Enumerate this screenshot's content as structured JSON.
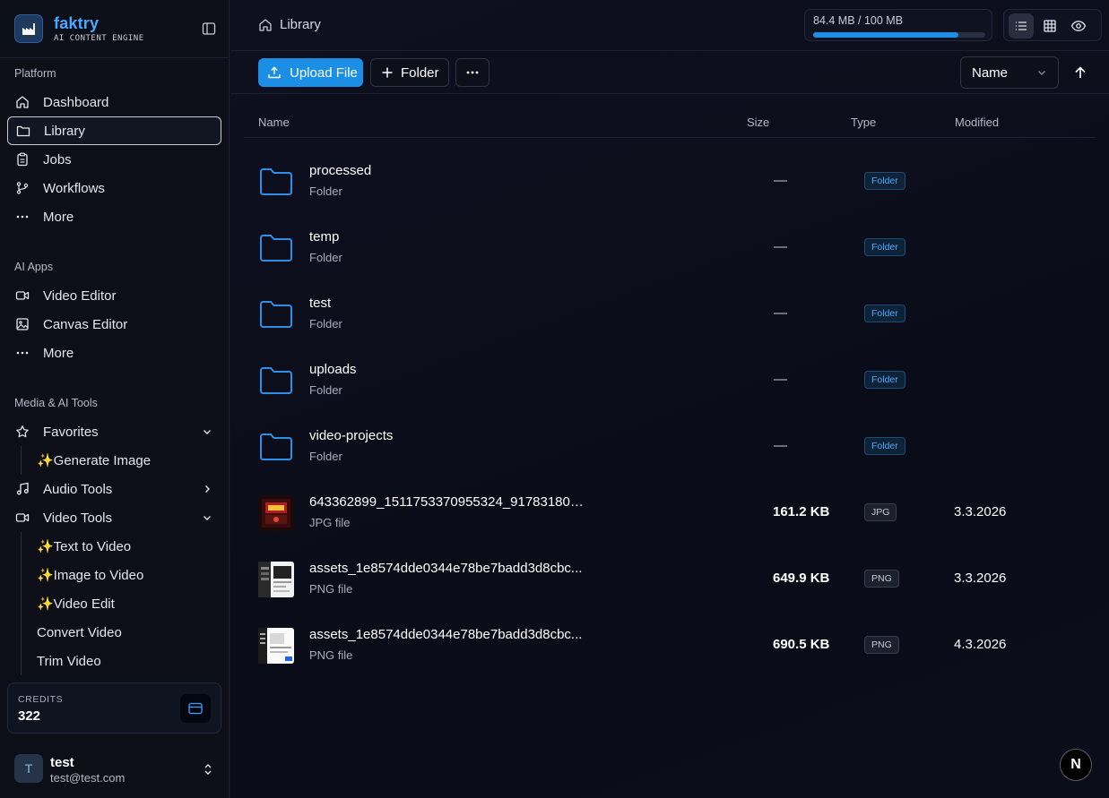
{
  "brand": {
    "name": "faktry",
    "tagline": "AI CONTENT ENGINE"
  },
  "sidebar": {
    "platform_label": "Platform",
    "platform_items": [
      {
        "label": "Dashboard",
        "icon": "home-icon"
      },
      {
        "label": "Library",
        "icon": "folder-icon",
        "active": true
      },
      {
        "label": "Jobs",
        "icon": "clipboard-icon"
      },
      {
        "label": "Workflows",
        "icon": "git-branch-icon"
      },
      {
        "label": "More",
        "icon": "ellipsis-icon"
      }
    ],
    "ai_apps_label": "AI Apps",
    "ai_apps_items": [
      {
        "label": "Video Editor",
        "icon": "video-icon"
      },
      {
        "label": "Canvas Editor",
        "icon": "image-icon"
      },
      {
        "label": "More",
        "icon": "ellipsis-icon"
      }
    ],
    "media_label": "Media & AI Tools",
    "favorites": {
      "label": "Favorites",
      "icon": "star-icon",
      "children": [
        "✨Generate Image"
      ]
    },
    "audio_tools": {
      "label": "Audio Tools",
      "icon": "music-icon"
    },
    "video_tools": {
      "label": "Video Tools",
      "icon": "video-icon",
      "children": [
        "✨Text to Video",
        "✨Image to Video",
        "✨Video Edit",
        "Convert Video",
        "Trim Video"
      ]
    }
  },
  "credits": {
    "label": "CREDITS",
    "value": "322"
  },
  "user": {
    "initial": "T",
    "name": "test",
    "email": "test@test.com"
  },
  "header": {
    "breadcrumb": "Library",
    "storage_text": "84.4 MB / 100 MB",
    "storage_used_fraction": 0.844
  },
  "toolbar": {
    "upload_label": "Upload File",
    "folder_label": "Folder",
    "sort_value": "Name"
  },
  "table": {
    "headers": {
      "name": "Name",
      "size": "Size",
      "type": "Type",
      "modified": "Modified"
    },
    "rows": [
      {
        "name": "processed",
        "sub": "Folder",
        "size": "—",
        "type": "Folder",
        "modified": "",
        "kind": "folder"
      },
      {
        "name": "temp",
        "sub": "Folder",
        "size": "—",
        "type": "Folder",
        "modified": "",
        "kind": "folder"
      },
      {
        "name": "test",
        "sub": "Folder",
        "size": "—",
        "type": "Folder",
        "modified": "",
        "kind": "folder"
      },
      {
        "name": "uploads",
        "sub": "Folder",
        "size": "—",
        "type": "Folder",
        "modified": "",
        "kind": "folder"
      },
      {
        "name": "video-projects",
        "sub": "Folder",
        "size": "—",
        "type": "Folder",
        "modified": "",
        "kind": "folder"
      },
      {
        "name": "643362899_1511753370955324_917831803...",
        "sub": "JPG file",
        "size": "161.2 KB",
        "type": "JPG",
        "modified": "3.3.2026",
        "kind": "jpg"
      },
      {
        "name": "assets_1e8574dde0344e78be7badd3d8cbc...",
        "sub": "PNG file",
        "size": "649.9 KB",
        "type": "PNG",
        "modified": "3.3.2026",
        "kind": "png1"
      },
      {
        "name": "assets_1e8574dde0344e78be7badd3d8cbc...",
        "sub": "PNG file",
        "size": "690.5 KB",
        "type": "PNG",
        "modified": "4.3.2026",
        "kind": "png2"
      }
    ]
  },
  "floating_badge": "N",
  "colors": {
    "accent": "#1b8ee6",
    "brand": "#4aa9ff",
    "background": "#0d0f1a"
  }
}
